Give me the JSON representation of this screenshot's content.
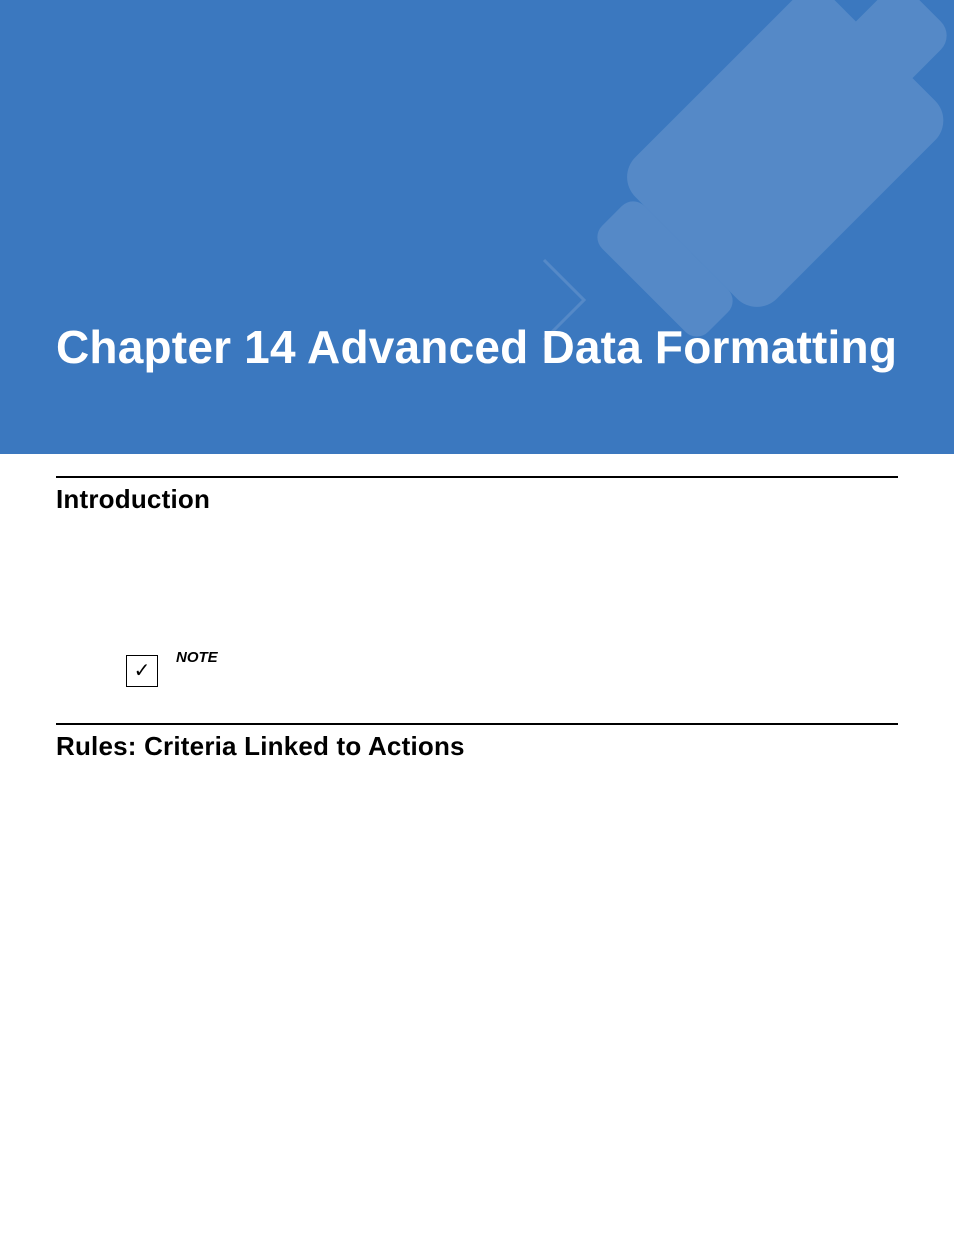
{
  "banner": {
    "title": "Chapter 14 Advanced Data Formatting"
  },
  "sections": {
    "intro_heading": "Introduction",
    "rules_heading": "Rules: Criteria Linked to Actions"
  },
  "note": {
    "label": "NOTE"
  },
  "colors": {
    "banner_bg": "#3b78bf",
    "text": "#000000",
    "banner_text": "#ffffff"
  }
}
